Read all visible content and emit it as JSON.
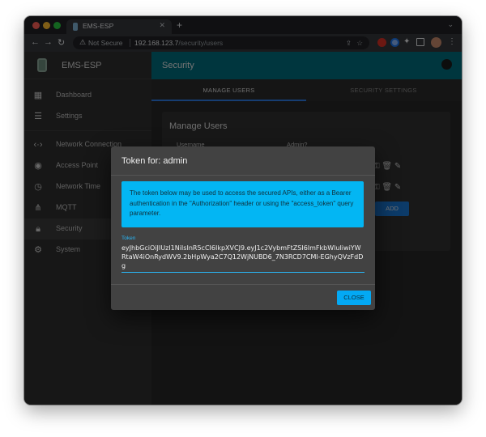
{
  "browser": {
    "tab_title": "EMS-ESP",
    "not_secure": "Not Secure",
    "url_host": "192.168.123.7",
    "url_path": "/security/users"
  },
  "app": {
    "brand": "EMS-ESP",
    "header_title": "Security"
  },
  "sidebar": {
    "items": [
      {
        "label": "Dashboard",
        "icon": "dashboard-icon"
      },
      {
        "label": "Settings",
        "icon": "tune-icon"
      },
      {
        "label": "Network Connection",
        "icon": "settings-ethernet-icon"
      },
      {
        "label": "Access Point",
        "icon": "settings-input-antenna-icon"
      },
      {
        "label": "Network Time",
        "icon": "access-time-icon"
      },
      {
        "label": "MQTT",
        "icon": "device-hub-icon"
      },
      {
        "label": "Security",
        "icon": "lock-icon"
      },
      {
        "label": "System",
        "icon": "gear-icon"
      }
    ],
    "active_index": 6
  },
  "tabs": [
    "MANAGE USERS",
    "SECURITY SETTINGS"
  ],
  "manage_users": {
    "title": "Manage Users",
    "columns": [
      "Username",
      "Admin?"
    ],
    "add_label": "ADD"
  },
  "dialog": {
    "title": "Token for: admin",
    "info": "The token below may be used to access the secured APIs, either as a Bearer authentication in the \"Authorization\" header or using the \"access_token\" query parameter.",
    "token_label": "Token",
    "token_value": "eyJhbGciOiJIUzI1NiIsInR5cCI6IkpXVCJ9.eyJ1c2VybmFtZSI6ImFkbWluIiwiYWRtaW4iOnRydWV9.2bHpWya2C7Q12WjNUBD6_7N3RCD7CMl-EGhyQVzFdDg",
    "close_label": "CLOSE"
  },
  "colors": {
    "header": "#006c7c",
    "info_box": "#03b6f3",
    "accent": "#29b6f6",
    "add_button": "#1976d2"
  }
}
